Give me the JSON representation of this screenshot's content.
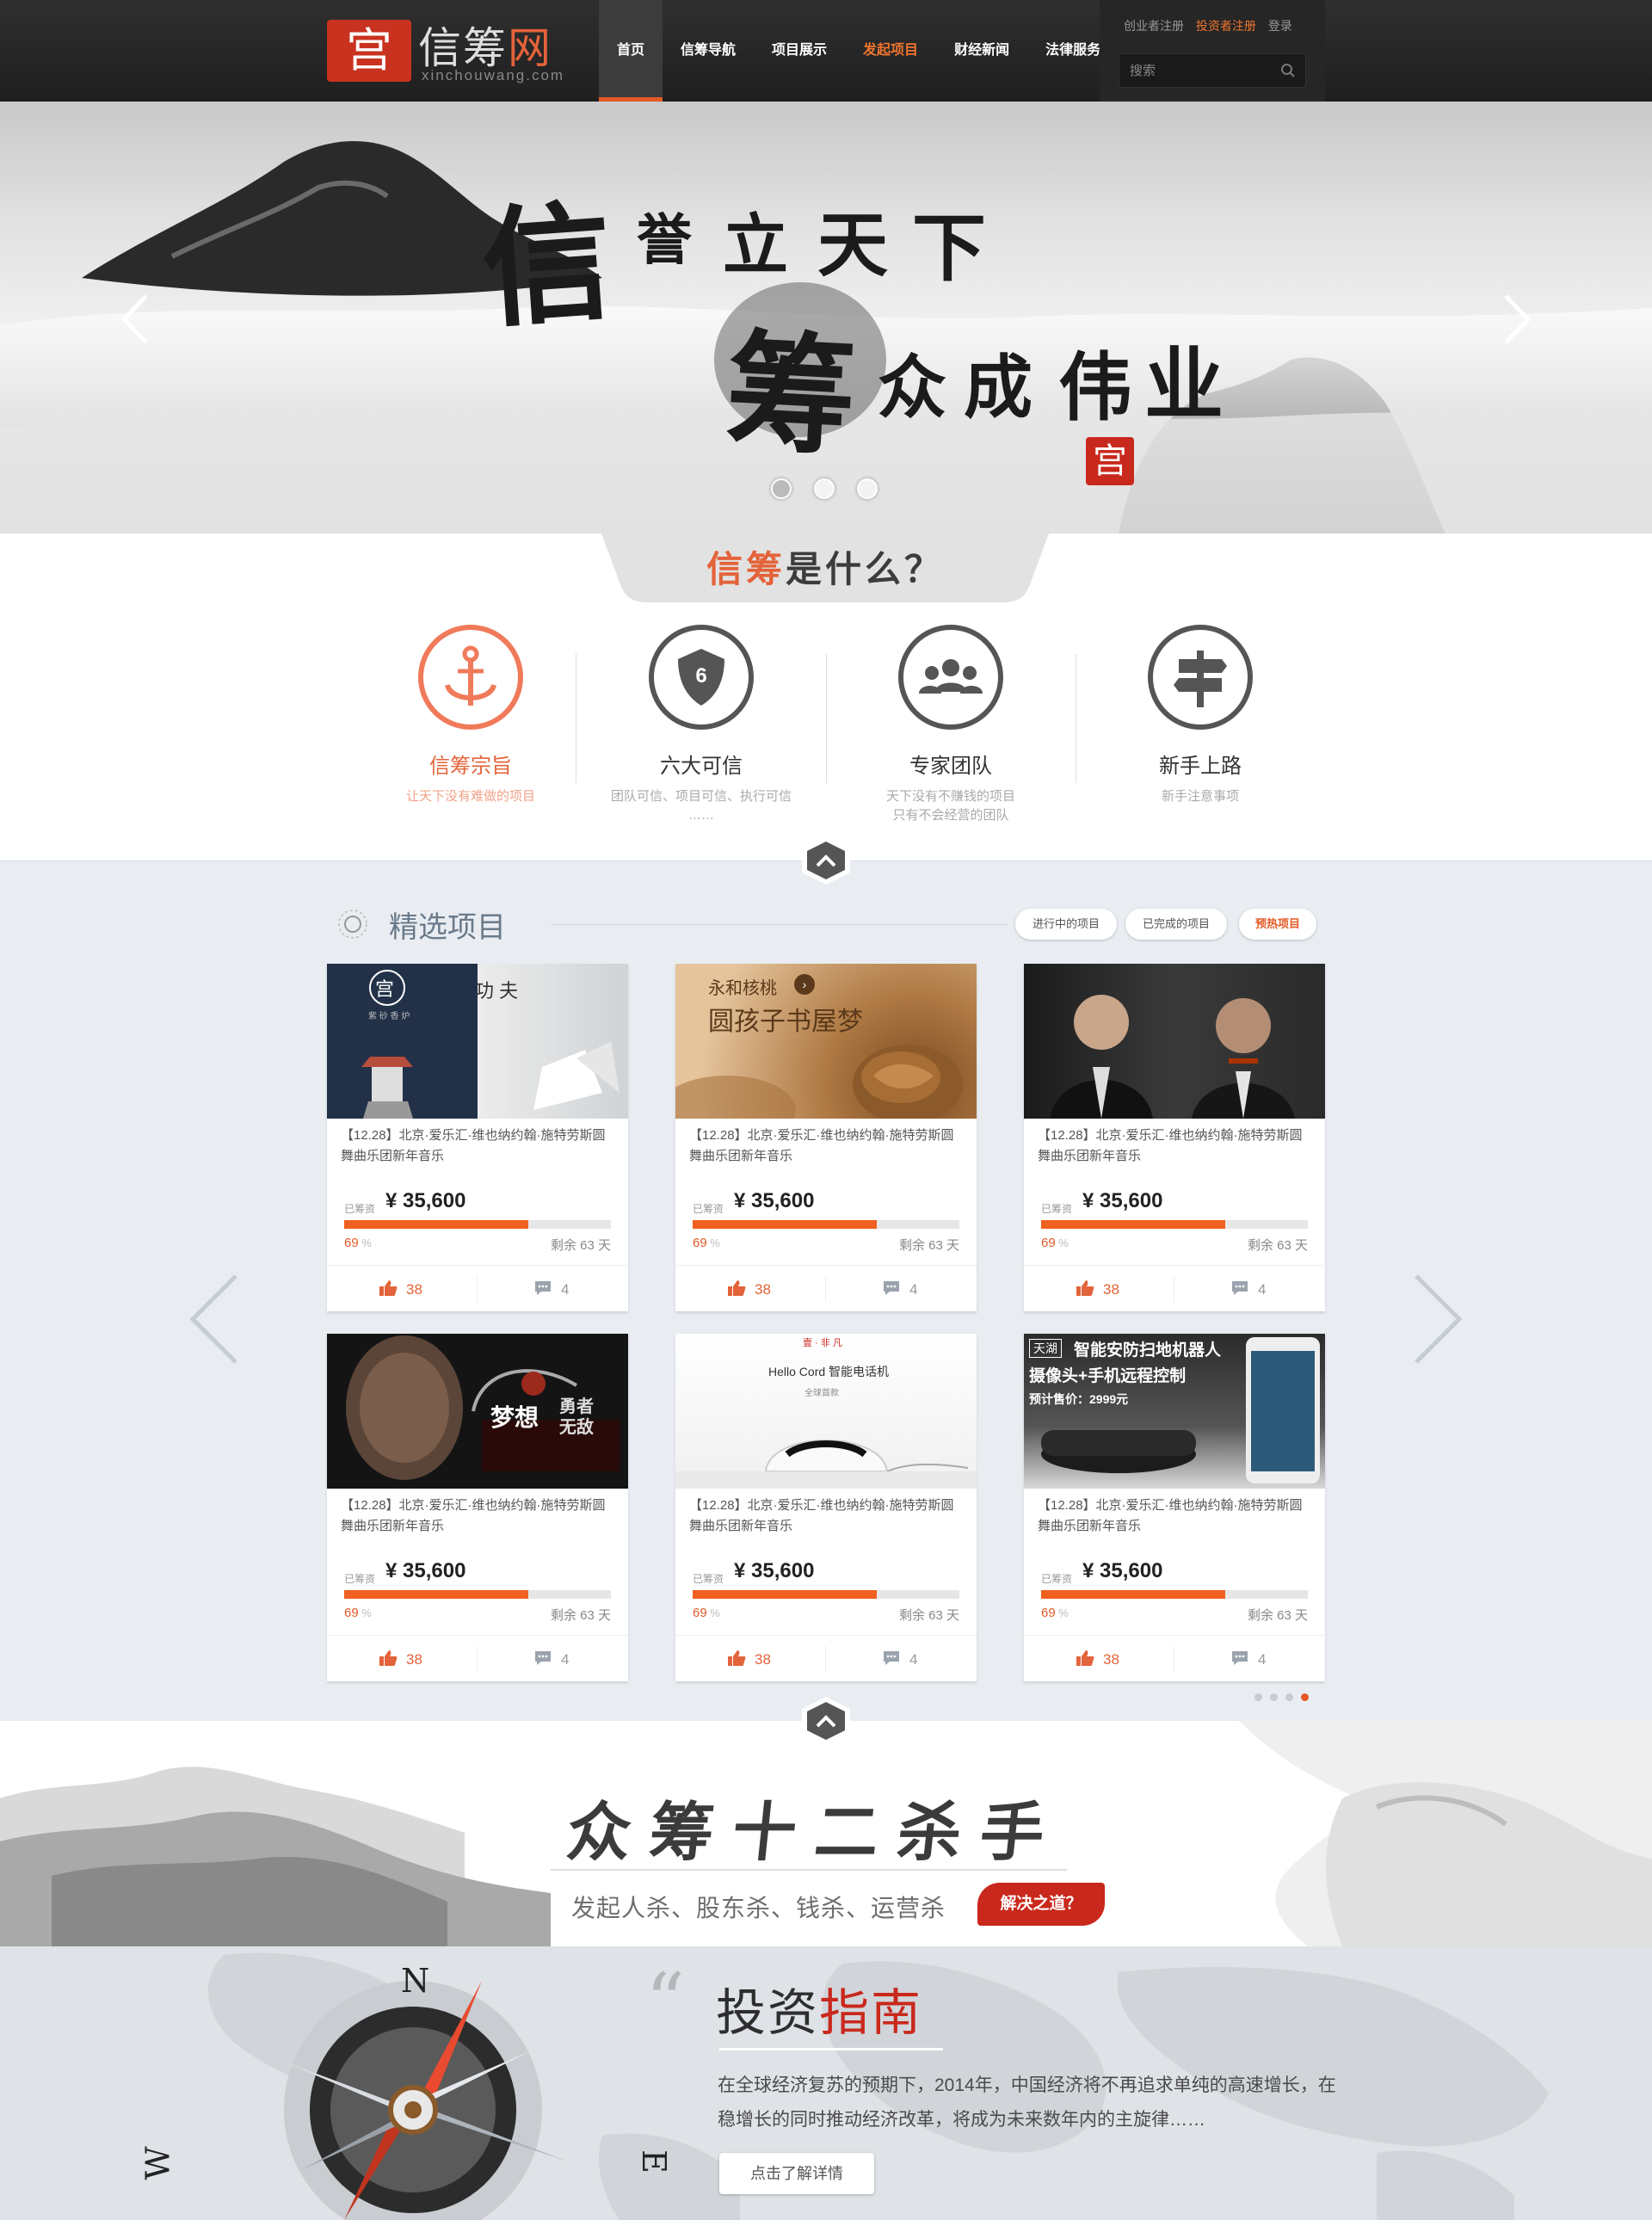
{
  "header": {
    "logo_mark": "宫",
    "logo_name_part1": "信筹",
    "logo_name_part2": "网",
    "logo_sub": "xinchouwang.com",
    "nav": [
      "首页",
      "信筹导航",
      "项目展示",
      "发起项目",
      "财经新闻",
      "法律服务"
    ],
    "links": [
      "创业者注册",
      "投资者注册",
      "登录"
    ],
    "search_placeholder": "搜索"
  },
  "hero": {
    "calligraphy": [
      "信",
      "誉",
      "立",
      "天",
      "下",
      "筹",
      "众",
      "成",
      "伟",
      "业"
    ],
    "seal": "宫",
    "slide_count": 3,
    "active_slide": 0
  },
  "what": {
    "title_hl": "信筹",
    "title_rest": "是什么？",
    "features": [
      {
        "title": "信筹宗旨",
        "desc": [
          "让天下没有难做的项目"
        ]
      },
      {
        "title": "六大可信",
        "desc": [
          "团队可信、项目可信、执行可信",
          "……"
        ]
      },
      {
        "title": "专家团队",
        "desc": [
          "天下没有不赚钱的项目",
          "只有不会经营的团队"
        ]
      },
      {
        "title": "新手上路",
        "desc": [
          "新手注意事项"
        ]
      }
    ],
    "six_badge": "6"
  },
  "projects": {
    "title": "精选项目",
    "tabs": [
      "进行中的项目",
      "已完成的项目",
      "预热项目"
    ],
    "active_tab": 2,
    "cards": [
      {
        "desc": "【12.28】北京·爱乐汇·维也纳约翰·施特劳斯圆舞曲乐团新年音乐",
        "label": "已筹资",
        "amount": "¥ 35,600",
        "pct_value": 69,
        "pct": "69",
        "pct_unit": " %",
        "remain": "剩余 63 天",
        "likes": "38",
        "comments": "4",
        "img_texts": [
          "宫",
          "功 夫",
          "紫 砂 香 炉"
        ]
      },
      {
        "desc": "【12.28】北京·爱乐汇·维也纳约翰·施特劳斯圆舞曲乐团新年音乐",
        "label": "已筹资",
        "amount": "¥ 35,600",
        "pct_value": 69,
        "pct": "69",
        "pct_unit": " %",
        "remain": "剩余 63 天",
        "likes": "38",
        "comments": "4",
        "img_texts": [
          "永和核桃",
          "圆孩子书屋梦"
        ]
      },
      {
        "desc": "【12.28】北京·爱乐汇·维也纳约翰·施特劳斯圆舞曲乐团新年音乐",
        "label": "已筹资",
        "amount": "¥ 35,600",
        "pct_value": 69,
        "pct": "69",
        "pct_unit": " %",
        "remain": "剩余 63 天",
        "likes": "38",
        "comments": "4",
        "img_texts": []
      },
      {
        "desc": "【12.28】北京·爱乐汇·维也纳约翰·施特劳斯圆舞曲乐团新年音乐",
        "label": "已筹资",
        "amount": "¥ 35,600",
        "pct_value": 69,
        "pct": "69",
        "pct_unit": " %",
        "remain": "剩余 63 天",
        "likes": "38",
        "comments": "4",
        "img_texts": [
          "梦想",
          "勇者",
          "无敌"
        ]
      },
      {
        "desc": "【12.28】北京·爱乐汇·维也纳约翰·施特劳斯圆舞曲乐团新年音乐",
        "label": "已筹资",
        "amount": "¥ 35,600",
        "pct_value": 69,
        "pct": "69",
        "pct_unit": " %",
        "remain": "剩余 63 天",
        "likes": "38",
        "comments": "4",
        "img_texts": [
          "壹 · 非 凡",
          "Hello Cord 智能电话机",
          "全球首款"
        ]
      },
      {
        "desc": "【12.28】北京·爱乐汇·维也纳约翰·施特劳斯圆舞曲乐团新年音乐",
        "label": "已筹资",
        "amount": "¥ 35,600",
        "pct_value": 69,
        "pct": "69",
        "pct_unit": " %",
        "remain": "剩余 63 天",
        "likes": "38",
        "comments": "4",
        "img_texts": [
          "天湖",
          "智能安防扫地机器人",
          "摄像头+手机远程控制",
          "预计售价：2999元"
        ]
      }
    ],
    "page_count": 4,
    "active_page": 3
  },
  "killers": {
    "title": "众筹十二杀手",
    "subtitle": "发起人杀、股东杀、钱杀、运营杀",
    "button": "解决之道？"
  },
  "guide": {
    "quote": "“",
    "title_part1": "投资",
    "title_part2": "指南",
    "text": "在全球经济复苏的预期下，2014年，中国经济将不再追求单纯的高速增长，在稳增长的同时推动经济改革，将成为未来数年内的主旋律……",
    "button": "点击了解详情",
    "compass_letters": [
      "N",
      "W",
      "E"
    ]
  },
  "colors": {
    "accent": "#e35a25",
    "red": "#c9281c",
    "header_bg": "#262626",
    "projects_bg": "#e9edf2"
  }
}
